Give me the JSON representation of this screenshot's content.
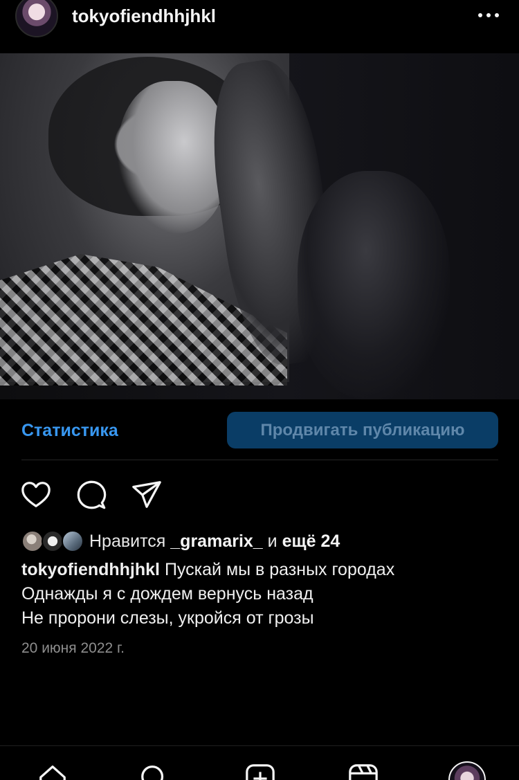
{
  "post": {
    "username": "tokyofiendhhjhkl",
    "more_icon": "more-horizontal-icon",
    "image_alt": ""
  },
  "insights": {
    "stats_label": "Статистика",
    "promote_label": "Продвигать публикацию"
  },
  "action_icons": [
    "heart-icon",
    "comment-icon",
    "share-icon"
  ],
  "likes": {
    "prefix": "Нравится",
    "user": "_gramarix_",
    "middle": "и",
    "others": "ещё 24"
  },
  "caption": {
    "user": "tokyofiendhhjhkl",
    "line1": "Пускай мы в разных городах",
    "line2": "Однажды я с дождем вернусь назад",
    "line3": "Не пророни слезы, укройся от грозы"
  },
  "date": "20 июня 2022 г.",
  "tabbar": {
    "icons": [
      "home-icon",
      "search-icon",
      "create-icon",
      "reels-icon",
      "profile-avatar"
    ]
  },
  "colors": {
    "background": "#000000",
    "link": "#3897f0",
    "promote_bg": "#0a3d66",
    "promote_text": "#5f87aa",
    "secondary_text": "#8e8e8e"
  }
}
